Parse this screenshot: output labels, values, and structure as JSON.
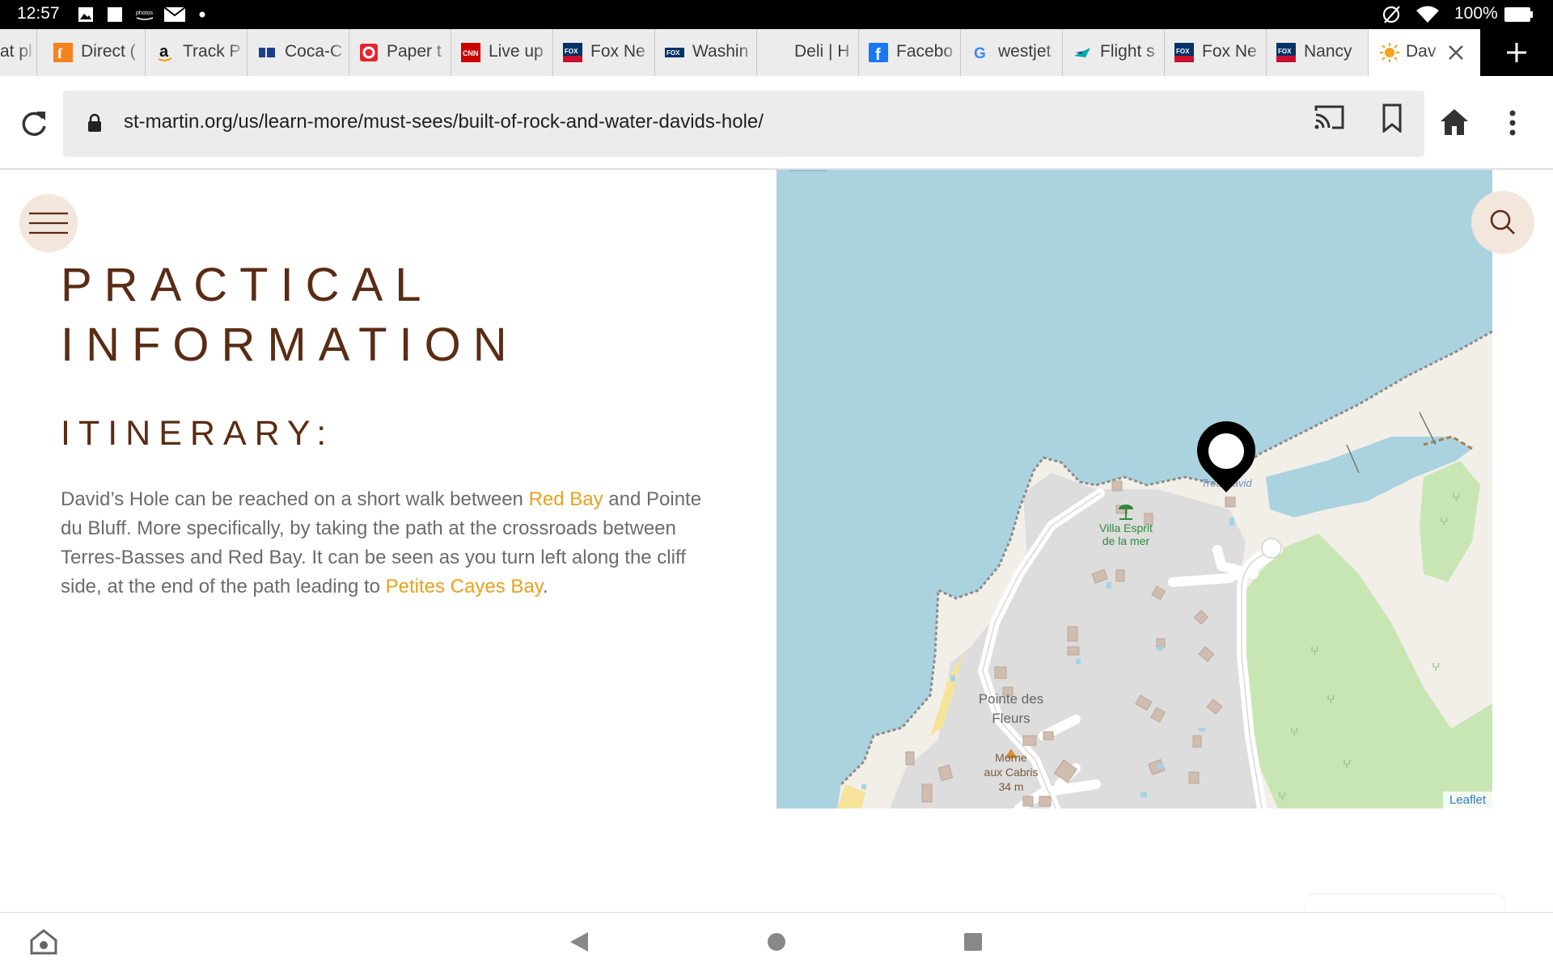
{
  "status_bar": {
    "time": "12:57",
    "battery": "100%",
    "icons": [
      "image-icon",
      "square-icon",
      "photos-icon",
      "mail-icon",
      "dot-icon",
      "no-sim-icon",
      "wifi-icon",
      "battery-icon"
    ]
  },
  "tabs": [
    {
      "label": "at pl",
      "favicon": "none"
    },
    {
      "label": "Direct (",
      "favicon": "fandango-icon"
    },
    {
      "label": "Track P",
      "favicon": "amazon-icon"
    },
    {
      "label": "Coca-C",
      "favicon": "coca-cola-icon"
    },
    {
      "label": "Paper t",
      "favicon": "paper-icon"
    },
    {
      "label": "Live up",
      "favicon": "cnn-icon"
    },
    {
      "label": "Fox Ne",
      "favicon": "fox-news-icon"
    },
    {
      "label": "Washin",
      "favicon": "fox-icon"
    },
    {
      "label": "Deli | H",
      "favicon": "none"
    },
    {
      "label": "Facebo",
      "favicon": "facebook-icon"
    },
    {
      "label": "westjet",
      "favicon": "google-icon"
    },
    {
      "label": "Flight s",
      "favicon": "westjet-icon"
    },
    {
      "label": "Fox Ne",
      "favicon": "fox-news-icon"
    },
    {
      "label": "Nancy",
      "favicon": "fox-news-icon"
    },
    {
      "label": "Dav",
      "favicon": "sun-icon",
      "active": true
    }
  ],
  "address_bar": {
    "url": "st-martin.org/us/learn-more/must-sees/built-of-rock-and-water-davids-hole/"
  },
  "page": {
    "title_line1": "PRACTICAL",
    "title_line2": "INFORMATION",
    "section_heading": "ITINERARY:",
    "body": {
      "part1": "David’s Hole can be reached on a short walk between ",
      "link1": "Red Bay",
      "part2": " and Pointe du Bluff. More specifically, by taking the path at the crossroads between Terres-Basses and Red Bay. It can be seen as you turn left along the cliff side, at the end of the path leading to ",
      "link2": "Petites Cayes Bay",
      "part3": "."
    },
    "accent_color": "#e9a11f",
    "title_color": "#5a2c14"
  },
  "map": {
    "labels": {
      "villa_line1": "Villa Esprit",
      "villa_line2": "de la mer",
      "pointe_line1": "Pointe des",
      "pointe_line2": "Fleurs",
      "morne_line1": "Morne",
      "morne_line2": "aux Cabris",
      "morne_line3": "34 m",
      "trou": "Trou David"
    },
    "attribution": "Leaflet",
    "water_color": "#aad3df",
    "land_color": "#f2efe9"
  }
}
